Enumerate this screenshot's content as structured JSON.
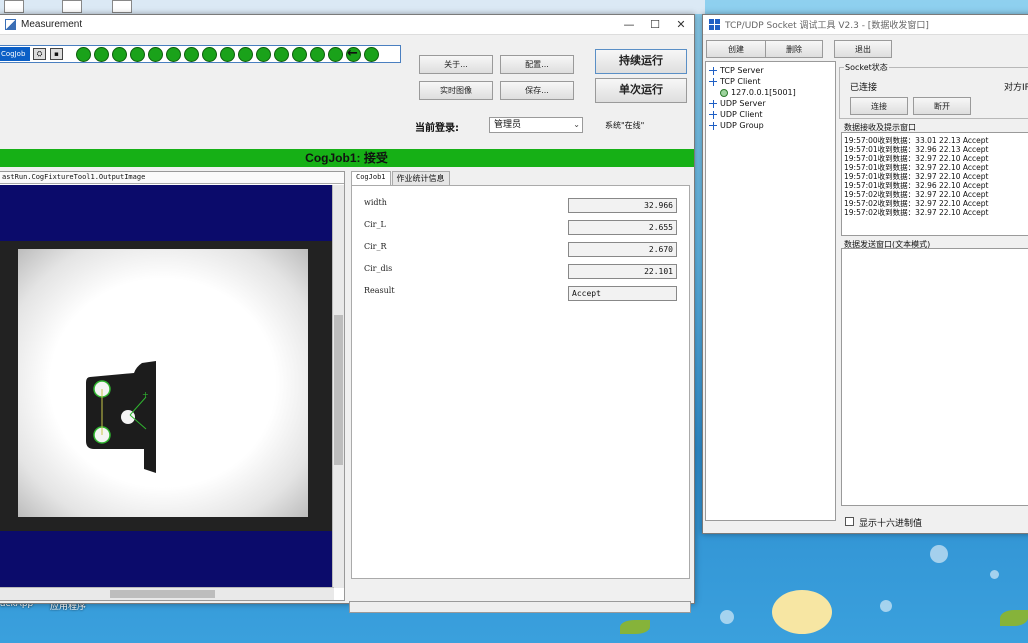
{
  "measurement": {
    "title": "Measurement",
    "job_tag": "CogJob",
    "buttons": {
      "about": "关于...",
      "config": "配置...",
      "realtime": "实时图像",
      "save": "保存...",
      "run_continuous": "持续运行",
      "run_once": "单次运行"
    },
    "login_label": "当前登录:",
    "login_value": "管理员",
    "system_status": "系统\"在线\"",
    "status_bar": "CogJob1: 接受",
    "image_header": "astRun.CogFixtureTool1.OutputImage",
    "tabs": [
      "CogJob1",
      "作业统计信息"
    ],
    "fields": [
      {
        "label": "width",
        "value": "32.966"
      },
      {
        "label": "Cir_L",
        "value": "2.655"
      },
      {
        "label": "Cir_R",
        "value": "2.670"
      },
      {
        "label": "Cir_dis",
        "value": "22.101"
      },
      {
        "label": "Reasult",
        "value": "Accept"
      }
    ],
    "dot_count": 16
  },
  "socket": {
    "title": "TCP/UDP Socket 调试工具 V2.3 - [数据收发窗口]",
    "toolbar": {
      "create": "创建",
      "delete": "删除",
      "exit": "退出"
    },
    "tree": {
      "tcp_server": "TCP Server",
      "tcp_client": "TCP Client",
      "client_conn": "127.0.0.1[5001]",
      "udp_server": "UDP Server",
      "udp_client": "UDP Client",
      "udp_group": "UDP Group"
    },
    "socket_state_title": "Socket状态",
    "connected": "已连接",
    "peer_label": "对方IP",
    "connect_btn": "连接",
    "disconnect_btn": "断开",
    "recv_title": "数据接收及提示窗口",
    "log": [
      "19:57:00收到数据：33.01   22.13   Accept",
      "19:57:01收到数据：32.96   22.13   Accept",
      "19:57:01收到数据：32.97   22.10   Accept",
      "19:57:01收到数据：32.97   22.10   Accept",
      "19:57:01收到数据：32.97   22.10   Accept",
      "19:57:01收到数据：32.96   22.10   Accept",
      "19:57:02收到数据：32.97   22.10   Accept",
      "19:57:02收到数据：32.97   22.10   Accept",
      "19:57:02收到数据：32.97   22.10   Accept"
    ],
    "send_title": "数据发送窗口(文本模式)",
    "hex_label": "显示十六进制值"
  },
  "desktop": {
    "label_left": "ackApp",
    "label_right": "应用程序"
  }
}
